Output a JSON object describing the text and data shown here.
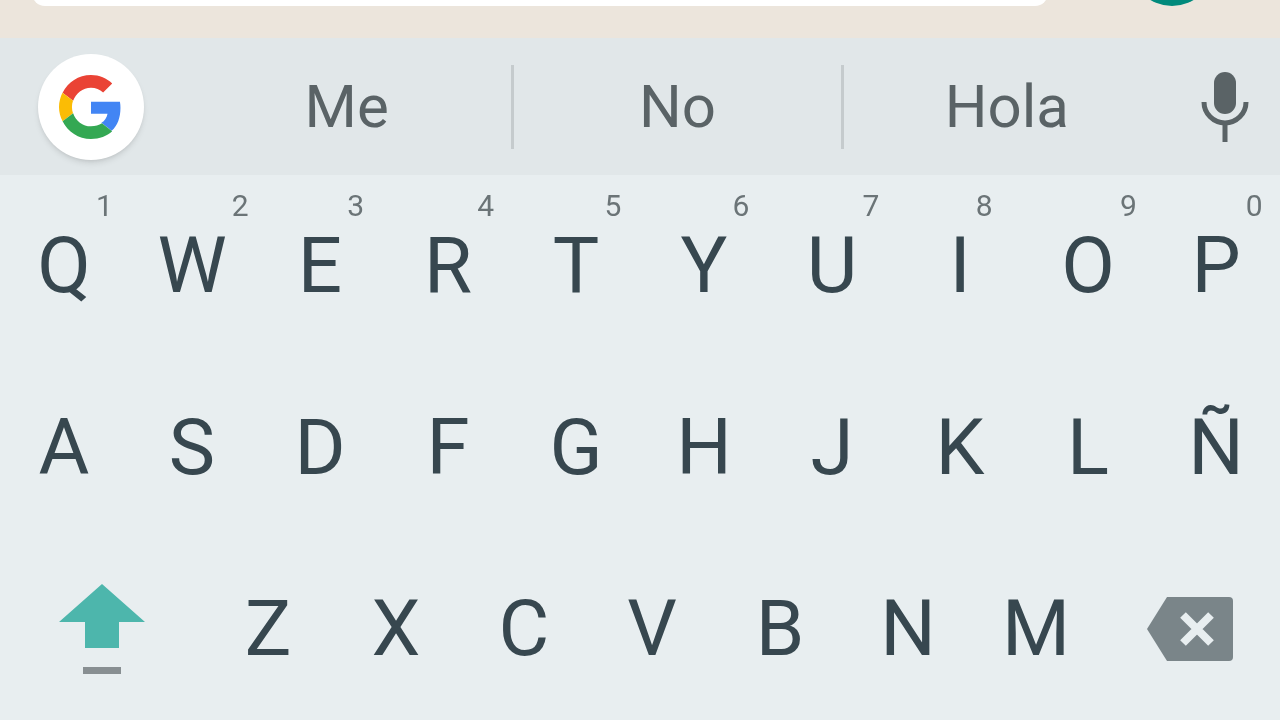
{
  "suggestions": [
    {
      "text": "Me"
    },
    {
      "text": "No"
    },
    {
      "text": "Hola"
    }
  ],
  "rows": [
    [
      {
        "kind": "letter",
        "label": "Q",
        "hint": "1"
      },
      {
        "kind": "letter",
        "label": "W",
        "hint": "2"
      },
      {
        "kind": "letter",
        "label": "E",
        "hint": "3"
      },
      {
        "kind": "letter",
        "label": "R",
        "hint": "4"
      },
      {
        "kind": "letter",
        "label": "T",
        "hint": "5"
      },
      {
        "kind": "letter",
        "label": "Y",
        "hint": "6"
      },
      {
        "kind": "letter",
        "label": "U",
        "hint": "7"
      },
      {
        "kind": "letter",
        "label": "I",
        "hint": "8"
      },
      {
        "kind": "letter",
        "label": "O",
        "hint": "9"
      },
      {
        "kind": "letter",
        "label": "P",
        "hint": "0"
      }
    ],
    [
      {
        "kind": "letter",
        "label": "A"
      },
      {
        "kind": "letter",
        "label": "S"
      },
      {
        "kind": "letter",
        "label": "D"
      },
      {
        "kind": "letter",
        "label": "F"
      },
      {
        "kind": "letter",
        "label": "G"
      },
      {
        "kind": "letter",
        "label": "H"
      },
      {
        "kind": "letter",
        "label": "J"
      },
      {
        "kind": "letter",
        "label": "K"
      },
      {
        "kind": "letter",
        "label": "L"
      },
      {
        "kind": "letter",
        "label": "Ñ"
      }
    ],
    [
      {
        "kind": "shift",
        "on": true
      },
      {
        "kind": "letter",
        "label": "Z"
      },
      {
        "kind": "letter",
        "label": "X"
      },
      {
        "kind": "letter",
        "label": "C"
      },
      {
        "kind": "letter",
        "label": "V"
      },
      {
        "kind": "letter",
        "label": "B"
      },
      {
        "kind": "letter",
        "label": "N"
      },
      {
        "kind": "letter",
        "label": "M"
      },
      {
        "kind": "backspace"
      }
    ]
  ]
}
